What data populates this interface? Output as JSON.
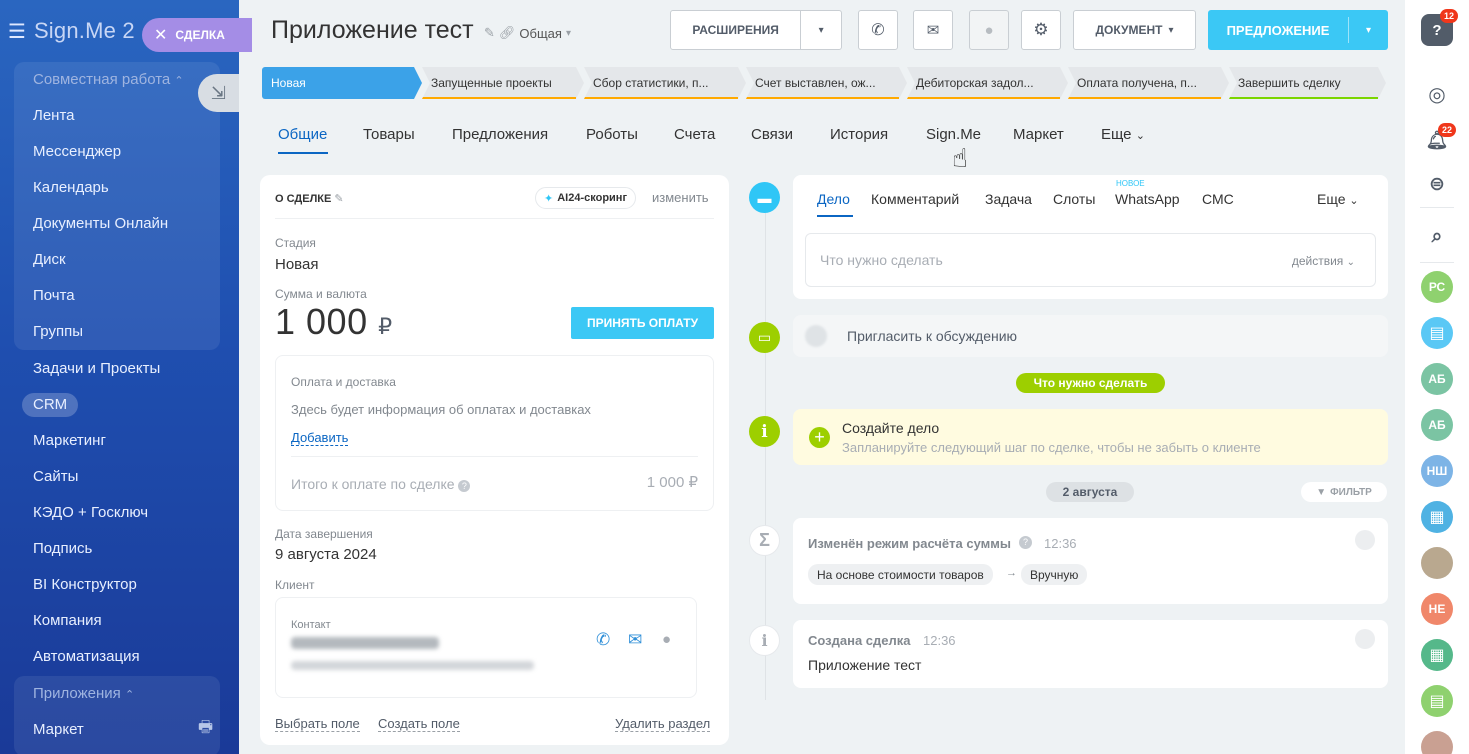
{
  "sidebar": {
    "logo": "Sign.Me 2",
    "deal_chip": "СДЕЛКА",
    "group1_header": "Совместная работа",
    "group1_items": [
      "Лента",
      "Мессенджер",
      "Календарь",
      "Документы Онлайн",
      "Диск",
      "Почта",
      "Группы"
    ],
    "items": [
      "Задачи и Проекты",
      "CRM",
      "Маркетинг",
      "Сайты",
      "КЭДО + Госключ",
      "Подпись",
      "BI Конструктор",
      "Компания",
      "Автоматизация"
    ],
    "group2_header": "Приложения",
    "group2_items": [
      "Маркет"
    ]
  },
  "header": {
    "title": "Приложение тест",
    "category": "Общая",
    "extensions": "РАСШИРЕНИЯ",
    "document": "ДОКУМЕНТ",
    "offer": "ПРЕДЛОЖЕНИЕ"
  },
  "stages": [
    {
      "label": "Новая",
      "color": "#3ba2e8"
    },
    {
      "label": "Запущенные проекты",
      "color": "#ffa900"
    },
    {
      "label": "Сбор статистики, п...",
      "color": "#ffa900"
    },
    {
      "label": "Счет выставлен, ож...",
      "color": "#ffa900"
    },
    {
      "label": "Дебиторская задол...",
      "color": "#ffa900"
    },
    {
      "label": "Оплата получена, п...",
      "color": "#ffa900"
    },
    {
      "label": "Завершить сделку",
      "color": "#7bd500"
    }
  ],
  "tabs": [
    "Общие",
    "Товары",
    "Предложения",
    "Роботы",
    "Счета",
    "Связи",
    "История",
    "Sign.Me",
    "Маркет",
    "Еще"
  ],
  "deal": {
    "header": "О СДЕЛКЕ",
    "ai_scoring": "AI24-скоринг",
    "change": "изменить",
    "stage_label": "Стадия",
    "stage_value": "Новая",
    "sum_label": "Сумма и валюта",
    "sum_value": "1 000",
    "currency": "₽",
    "accept_payment": "ПРИНЯТЬ ОПЛАТУ",
    "payment_title": "Оплата и доставка",
    "payment_desc": "Здесь будет информация об оплатах и доставках",
    "add_link": "Добавить",
    "total_label": "Итого к оплате по сделке",
    "total_value": "1 000 ₽",
    "close_date_label": "Дата завершения",
    "close_date_value": "9 августа 2024",
    "client_label": "Клиент",
    "contact_label": "Контакт",
    "select_field": "Выбрать поле",
    "create_field": "Создать поле",
    "delete_section": "Удалить раздел"
  },
  "editor": {
    "tabs": [
      "Дело",
      "Комментарий",
      "Задача",
      "Слоты",
      "WhatsApp",
      "СМС"
    ],
    "new_badge": "НОВОЕ",
    "more": "Еще",
    "placeholder": "Что нужно сделать",
    "actions": "действия"
  },
  "timeline": {
    "invite": "Пригласить к обсуждению",
    "todo_pill": "Что нужно сделать",
    "create_title": "Создайте дело",
    "create_desc": "Запланируйте следующий шаг по сделке, чтобы не забыть о клиенте",
    "date_pill": "2 августа",
    "filter": "ФИЛЬТР",
    "event1_title": "Изменён режим расчёта суммы",
    "event1_time": "12:36",
    "event1_from": "На основе стоимости товаров",
    "event1_to": "Вручную",
    "event2_title": "Создана сделка",
    "event2_time": "12:36",
    "event2_body": "Приложение тест"
  },
  "rail": {
    "help_badge": "12",
    "notif_badge": "22",
    "avatars": [
      {
        "text": "РС",
        "color": "#8fd16f"
      },
      {
        "text": "АБ",
        "color": "#7bc4a3"
      },
      {
        "text": "АБ",
        "color": "#7bc4a3"
      },
      {
        "text": "НШ",
        "color": "#7db4e6"
      },
      {
        "text": "НЕ",
        "color": "#f0876a"
      }
    ]
  }
}
